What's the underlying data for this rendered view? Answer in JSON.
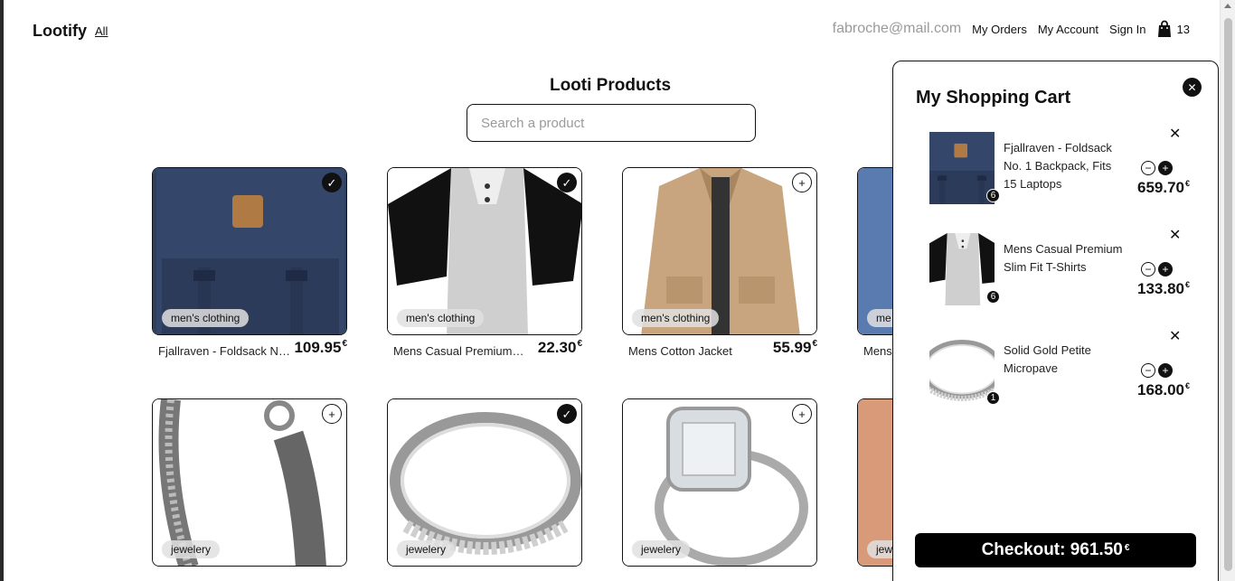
{
  "header": {
    "brand": "Lootify",
    "all_link": "All",
    "email": "fabroche@mail.com",
    "links": [
      "My Orders",
      "My Account",
      "Sign In"
    ],
    "cart_count": "13"
  },
  "main": {
    "title": "Looti Products",
    "search_placeholder": "Search a product"
  },
  "currency_symbol": "€",
  "products": [
    {
      "name": "Fjallraven - Foldsack No. 1 Backpack, Fits 15 Laptops",
      "price": "109.95",
      "category": "men's clothing",
      "in_cart": true,
      "icon": "backpack"
    },
    {
      "name": "Mens Casual Premium Slim Fit T-Shirts",
      "price": "22.30",
      "category": "men's clothing",
      "in_cart": true,
      "icon": "tshirt"
    },
    {
      "name": "Mens Cotton Jacket",
      "price": "55.99",
      "category": "men's clothing",
      "in_cart": false,
      "icon": "jacket"
    },
    {
      "name": "Mens",
      "price": "",
      "category": "me",
      "in_cart": false,
      "icon": "shirt-blue"
    },
    {
      "name": "",
      "price": "",
      "category": "jewelery",
      "in_cart": false,
      "icon": "bracelet"
    },
    {
      "name": "",
      "price": "",
      "category": "jewelery",
      "in_cart": true,
      "icon": "ring-silver"
    },
    {
      "name": "",
      "price": "",
      "category": "jewelery",
      "in_cart": false,
      "icon": "ring-diamond"
    },
    {
      "name": "",
      "price": "",
      "category": "jew",
      "in_cart": false,
      "icon": "ring-rose"
    }
  ],
  "cart": {
    "title": "My Shopping Cart",
    "items": [
      {
        "name": "Fjallraven - Foldsack No. 1 Backpack, Fits 15 Laptops",
        "qty": "6",
        "price": "659.70",
        "icon": "backpack"
      },
      {
        "name": "Mens Casual Premium Slim Fit T-Shirts",
        "qty": "6",
        "price": "133.80",
        "icon": "tshirt"
      },
      {
        "name": "Solid Gold Petite Micropave",
        "qty": "1",
        "price": "168.00",
        "icon": "ring-silver"
      }
    ],
    "checkout_label": "Checkout: 961.50"
  },
  "colors": {
    "accent": "#000000",
    "muted_text": "#9a9a9a",
    "badge_bg": "#e1e1e1"
  }
}
